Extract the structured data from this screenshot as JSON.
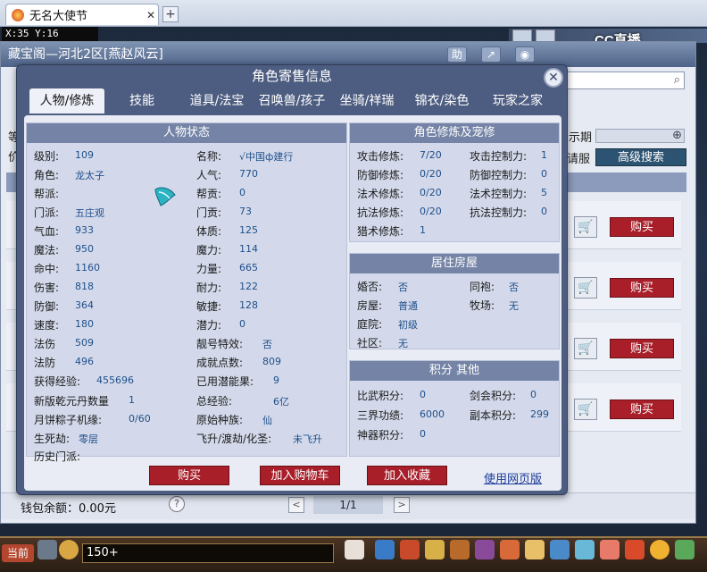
{
  "browser": {
    "tab_title": "无名大使节",
    "close_glyph": "✕",
    "new_tab_glyph": "+"
  },
  "coords": "X:35 Y:16",
  "overlay_brand": "CC直播",
  "market": {
    "title": "藏宝阁—河北2区[燕赵风云]",
    "title_buttons": [
      "助",
      "↗",
      "◉"
    ],
    "partial_labels": {
      "left1": "等",
      "left2": "价",
      "right1": "示期",
      "right2": "请服"
    },
    "advanced_search": "高级搜索",
    "buy_label": "购买",
    "wallet": "钱包余额：0.00元",
    "help": "?",
    "pager": "1/1",
    "prev": "<",
    "next": ">"
  },
  "gamebar": {
    "channel": "当前",
    "chat_value": "150+"
  },
  "dialog": {
    "title": "角色寄售信息",
    "close_glyph": "✕",
    "tabs": [
      "人物/修炼",
      "技能",
      "道具/法宝",
      "召唤兽/孩子",
      "坐骑/祥瑞",
      "锦衣/染色",
      "玩家之家"
    ],
    "status": {
      "header": "人物状态",
      "rows": [
        {
          "l1": "级别:",
          "v1": "109",
          "l2": "名称:",
          "v2": "√中国ф建行"
        },
        {
          "l1": "角色:",
          "v1": "龙太子",
          "l2": "人气:",
          "v2": "770"
        },
        {
          "l1": "帮派:",
          "v1": "",
          "l2": "帮贡:",
          "v2": "0"
        },
        {
          "l1": "门派:",
          "v1": "五庄观",
          "l2": "门贡:",
          "v2": "73"
        },
        {
          "l1": "气血:",
          "v1": "933",
          "l2": "体质:",
          "v2": "125"
        },
        {
          "l1": "魔法:",
          "v1": "950",
          "l2": "魔力:",
          "v2": "114"
        },
        {
          "l1": "命中:",
          "v1": "1160",
          "l2": "力量:",
          "v2": "665"
        },
        {
          "l1": "伤害:",
          "v1": "818",
          "l2": "耐力:",
          "v2": "122"
        },
        {
          "l1": "防御:",
          "v1": "364",
          "l2": "敏捷:",
          "v2": "128"
        },
        {
          "l1": "速度:",
          "v1": "180",
          "l2": "潜力:",
          "v2": "0"
        },
        {
          "l1": "法伤",
          "v1": "509",
          "l2": "靓号特效:",
          "v2": "否"
        },
        {
          "l1": "法防",
          "v1": "496",
          "l2": "成就点数:",
          "v2": "809"
        },
        {
          "l1": "获得经验:",
          "v1": "455696",
          "l2": "已用潜能果:",
          "v2": "9"
        },
        {
          "l1": "新版乾元丹数量",
          "v1": "1",
          "l2": "总经验:",
          "v2": "6亿"
        },
        {
          "l1": "月饼粽子机缘:",
          "v1": "0/60",
          "l2": "原始种族:",
          "v2": "仙"
        },
        {
          "l1": "生死劫:",
          "v1": "零层",
          "l2": "飞升/渡劫/化圣:",
          "v2": "未飞升"
        },
        {
          "l1": "历史门派:",
          "v1": "",
          "l2": "",
          "v2": ""
        }
      ]
    },
    "cultivation": {
      "header": "角色修炼及宠修",
      "rows": [
        {
          "l1": "攻击修炼:",
          "v1": "7/20",
          "l2": "攻击控制力:",
          "v2": "1"
        },
        {
          "l1": "防御修炼:",
          "v1": "0/20",
          "l2": "防御控制力:",
          "v2": "0"
        },
        {
          "l1": "法术修炼:",
          "v1": "0/20",
          "l2": "法术控制力:",
          "v2": "5"
        },
        {
          "l1": "抗法修炼:",
          "v1": "0/20",
          "l2": "抗法控制力:",
          "v2": "0"
        },
        {
          "l1": "猎术修炼:",
          "v1": "1",
          "l2": "",
          "v2": ""
        }
      ]
    },
    "housing": {
      "header": "居住房屋",
      "rows": [
        {
          "l1": "婚否:",
          "v1": "否",
          "l2": "同袍:",
          "v2": "否"
        },
        {
          "l1": "房屋:",
          "v1": "普通",
          "l2": "牧场:",
          "v2": "无"
        },
        {
          "l1": "庭院:",
          "v1": "初级",
          "l2": "",
          "v2": ""
        },
        {
          "l1": "社区:",
          "v1": "无",
          "l2": "",
          "v2": ""
        }
      ]
    },
    "points": {
      "header": "积分 其他",
      "rows": [
        {
          "l1": "比武积分:",
          "v1": "0",
          "l2": "剑会积分:",
          "v2": "0"
        },
        {
          "l1": "三界功绩:",
          "v1": "6000",
          "l2": "副本积分:",
          "v2": "299"
        },
        {
          "l1": "神器积分:",
          "v1": "0",
          "l2": "",
          "v2": ""
        }
      ]
    },
    "buttons": {
      "buy": "购买",
      "add_cart": "加入购物车",
      "add_fav": "加入收藏",
      "web_version": "使用网页版"
    }
  }
}
